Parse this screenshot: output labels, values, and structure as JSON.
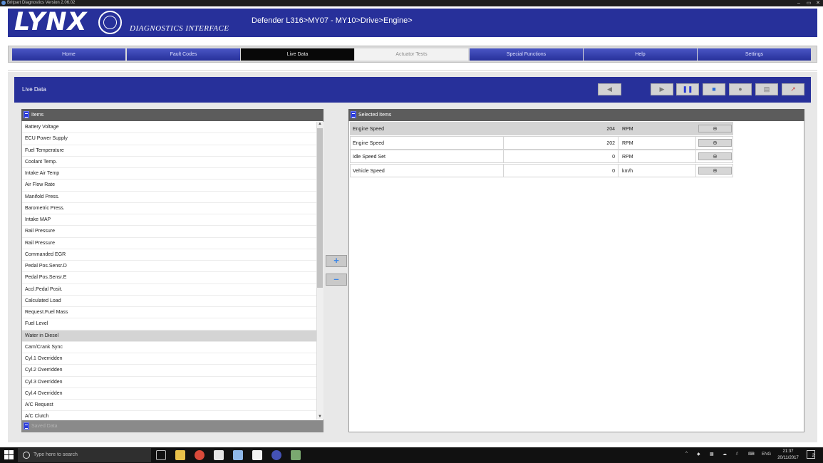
{
  "window": {
    "title": "Britpart Diagnostics Version 2.06.02",
    "controls": {
      "minimize": "–",
      "maximize": "▭",
      "close": "✕"
    }
  },
  "header": {
    "logo": "LYNX",
    "subtitle": "DIAGNOSTICS INTERFACE",
    "breadcrumb": "Defender L316>MY07 - MY10>Drive>Engine>"
  },
  "nav": {
    "tabs": [
      {
        "label": "Home"
      },
      {
        "label": "Fault Codes"
      },
      {
        "label": "Live Data"
      },
      {
        "label": "Actuator Tests"
      },
      {
        "label": "Special Functions"
      },
      {
        "label": "Help"
      },
      {
        "label": "Settings"
      }
    ],
    "active": "Live Data"
  },
  "panel": {
    "title": "Live Data",
    "toolbar": {
      "back_icon": "back-arrow-icon",
      "play_icon": "play-icon",
      "pause_icon": "pause-icon",
      "stop_icon": "stop-icon",
      "record_icon": "record-icon",
      "report_icon": "report-icon",
      "graph_icon": "graph-icon"
    }
  },
  "items": {
    "title": "Items",
    "list": [
      "Battery Voltage",
      "ECU Power Supply",
      "Fuel Temperature",
      "Coolant Temp.",
      "Intake Air Temp",
      "Air Flow Rate",
      "Manifold Press.",
      "Barometric Press.",
      "Intake MAP",
      "Rail Pressure",
      "Rail Pressure",
      "Commanded EGR",
      "Pedal Pos.Sensr.D",
      "Pedal Pos.Sensr.E",
      "Accl.Pedal Posit.",
      "Calculated Load",
      "Request.Fuel Mass",
      "Fuel Level",
      "Water in Diesel",
      "Cam/Crank Sync",
      "Cyl.1 Overridden",
      "Cyl.2 Overridden",
      "Cyl.3 Overridden",
      "Cyl.4 Overridden",
      "A/C Request",
      "A/C Clutch"
    ],
    "selected": "Water in Diesel",
    "saved_label": "Saved Data"
  },
  "selected_items": {
    "title": "Selected Items",
    "rows": [
      {
        "name": "Engine Speed",
        "value": "204",
        "unit": "RPM"
      },
      {
        "name": "Engine Speed",
        "value": "202",
        "unit": "RPM"
      },
      {
        "name": "Idle Speed Set",
        "value": "0",
        "unit": "RPM"
      },
      {
        "name": "Vehicle Speed",
        "value": "0",
        "unit": "km/h"
      }
    ]
  },
  "taskbar": {
    "search_placeholder": "Type here to search",
    "language": "ENG",
    "time": "21:37",
    "date": "20/11/2017",
    "notification_count": "2"
  }
}
